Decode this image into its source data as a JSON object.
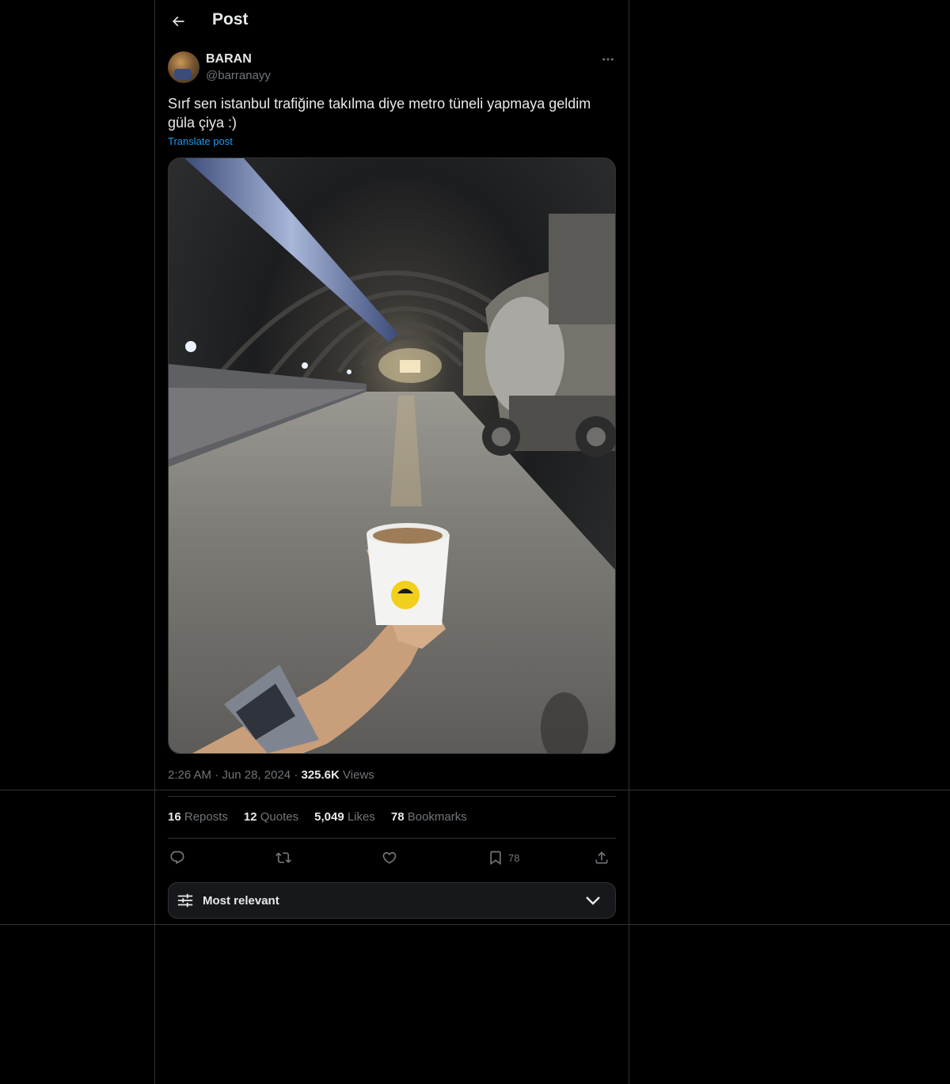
{
  "header": {
    "title": "Post",
    "back_icon": "arrow-left-icon"
  },
  "author": {
    "display_name": "BARAN",
    "handle": "@barranayy"
  },
  "post": {
    "text": "Sırf sen istanbul trafiğine takılma diye metro tüneli yapmaya geldim güla çiya :)",
    "translate_label": "Translate post",
    "media_description": "Hand holding a paper tea cup inside a metro tunnel under construction with a concrete mixer truck"
  },
  "meta": {
    "time": "2:26 AM",
    "date": "Jun 28, 2024",
    "views_count": "325.6K",
    "views_label": "Views"
  },
  "stats": {
    "reposts_count": "16",
    "reposts_label": "Reposts",
    "quotes_count": "12",
    "quotes_label": "Quotes",
    "likes_count": "5,049",
    "likes_label": "Likes",
    "bookmarks_count": "78",
    "bookmarks_label": "Bookmarks"
  },
  "actions": {
    "bookmark_count": "78"
  },
  "sort": {
    "label": "Most relevant"
  },
  "colors": {
    "background": "#000000",
    "border": "#2f3336",
    "text": "#e7e9ea",
    "muted": "#71767b",
    "link": "#1d9bf0"
  }
}
